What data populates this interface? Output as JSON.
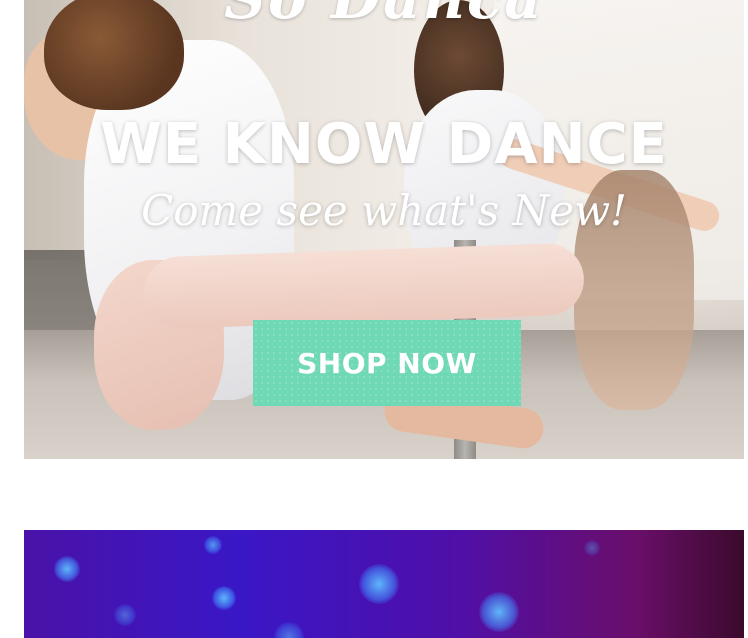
{
  "banner_dance": {
    "brand_partial": "So Danca",
    "headline": "WE KNOW DANCE",
    "subline": "Come see what's New!",
    "cta_label": "SHOP NOW",
    "cta_color": "#6fd8b4",
    "image_alt": "ballet dancers stretching at the barre"
  },
  "banner_blue": {
    "image_alt": "purple background with blue bokeh lights"
  }
}
